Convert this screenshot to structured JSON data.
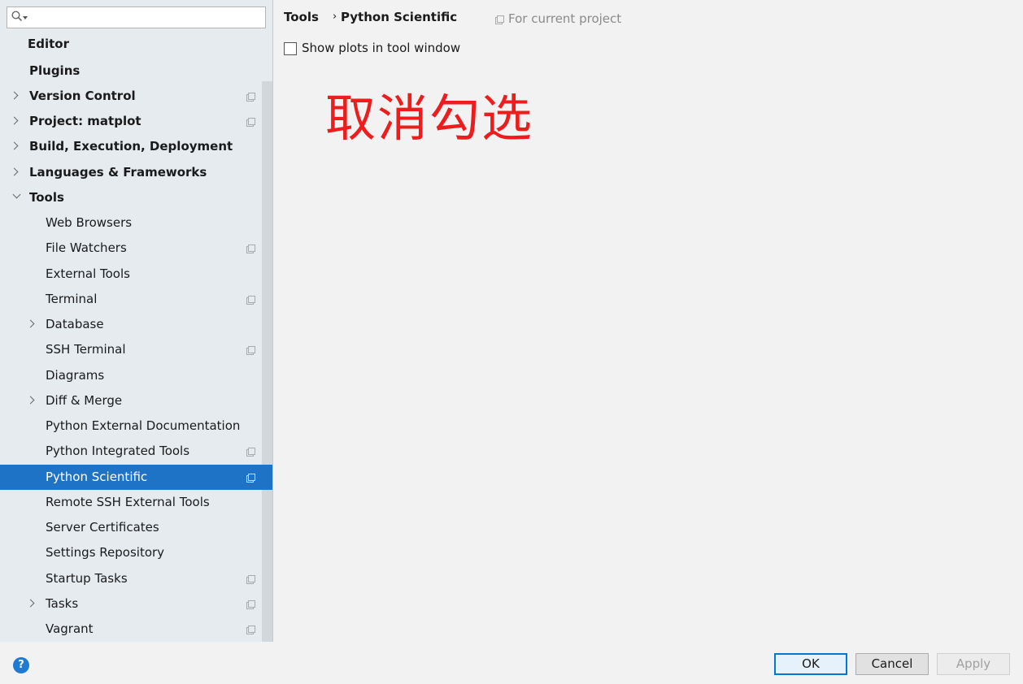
{
  "sidebar": {
    "search": {
      "value": "",
      "placeholder": ""
    },
    "items": [
      {
        "label": "Editor"
      },
      {
        "label": "Plugins"
      },
      {
        "label": "Version Control"
      },
      {
        "label": "Project: matplot"
      },
      {
        "label": "Build, Execution, Deployment"
      },
      {
        "label": "Languages & Frameworks"
      },
      {
        "label": "Tools"
      },
      {
        "label": "Web Browsers"
      },
      {
        "label": "File Watchers"
      },
      {
        "label": "External Tools"
      },
      {
        "label": "Terminal"
      },
      {
        "label": "Database"
      },
      {
        "label": "SSH Terminal"
      },
      {
        "label": "Diagrams"
      },
      {
        "label": "Diff & Merge"
      },
      {
        "label": "Python External Documentation"
      },
      {
        "label": "Python Integrated Tools"
      },
      {
        "label": "Python Scientific"
      },
      {
        "label": "Remote SSH External Tools"
      },
      {
        "label": "Server Certificates"
      },
      {
        "label": "Settings Repository"
      },
      {
        "label": "Startup Tasks"
      },
      {
        "label": "Tasks"
      },
      {
        "label": "Vagrant"
      }
    ]
  },
  "main": {
    "breadcrumb": {
      "part1": "Tools",
      "separator": "›",
      "part2": "Python Scientific"
    },
    "scope_note": "For current project",
    "show_plots": {
      "label": "Show plots in tool window",
      "checked": false
    },
    "annotation": "取消勾选"
  },
  "footer": {
    "help": "?",
    "ok": "OK",
    "cancel": "Cancel",
    "apply": "Apply"
  },
  "colors": {
    "selection": "#1f73c6",
    "annotation": "#ee1c1c",
    "ok_border": "#0078d7"
  }
}
